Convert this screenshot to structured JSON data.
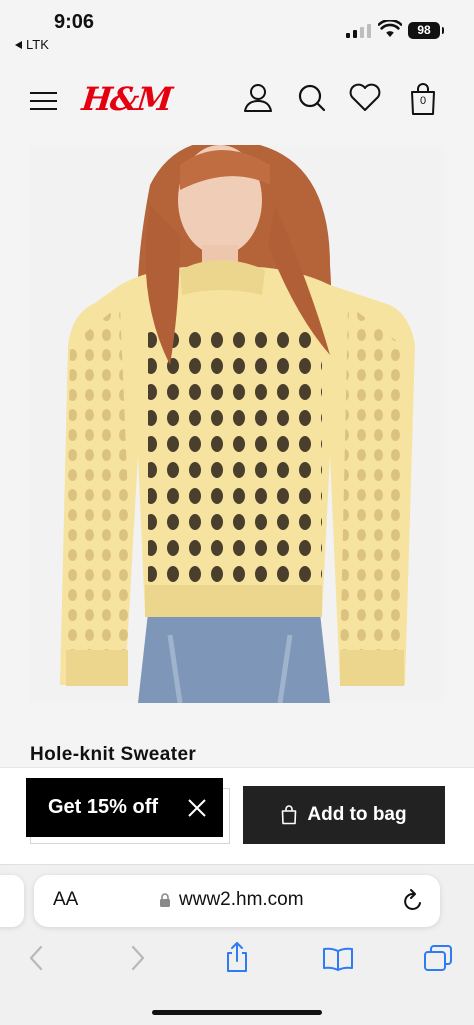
{
  "status_bar": {
    "time": "9:06",
    "back_app": "LTK",
    "battery": "98"
  },
  "header": {
    "logo": "H&M",
    "bag_count": "0",
    "icons": [
      "menu-icon",
      "account-icon",
      "search-icon",
      "heart-icon",
      "bag-icon"
    ]
  },
  "product": {
    "title": "Hole-knit Sweater",
    "image": "model wearing yellow open-knit sweater"
  },
  "promo": {
    "label": "Get 15% off"
  },
  "actions": {
    "add_to_bag": "Add to bag"
  },
  "browser": {
    "text_size": "AA",
    "url": "www2.hm.com",
    "toolbar": [
      "back",
      "forward",
      "share",
      "bookmarks",
      "tabs"
    ]
  },
  "colors": {
    "brand_red": "#e50010",
    "sweater_yellow": "#f6e3a0",
    "accent_blue": "#2f7bf6"
  }
}
